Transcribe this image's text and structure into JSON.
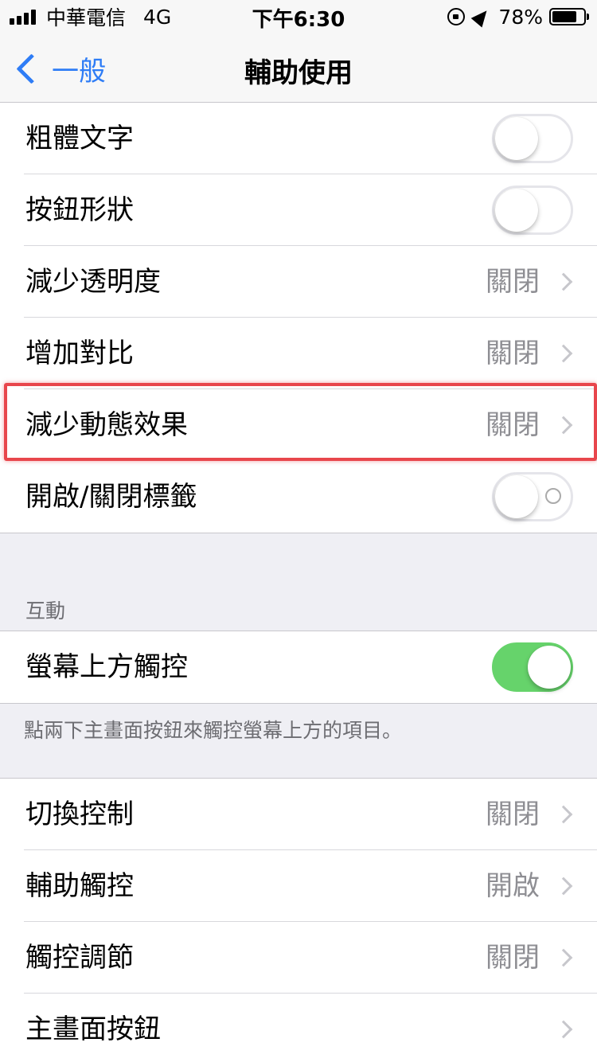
{
  "status_bar": {
    "carrier": "中華電信",
    "network": "4G",
    "time": "下午6:30",
    "battery_percent": "78%",
    "battery_level": 0.78
  },
  "nav": {
    "back_label": "一般",
    "title": "輔助使用"
  },
  "group1": {
    "rows": [
      {
        "label": "粗體文字",
        "type": "toggle",
        "on": false
      },
      {
        "label": "按鈕形狀",
        "type": "toggle",
        "on": false
      },
      {
        "label": "減少透明度",
        "type": "link",
        "value": "關閉"
      },
      {
        "label": "增加對比",
        "type": "link",
        "value": "關閉"
      },
      {
        "label": "減少動態效果",
        "type": "link",
        "value": "關閉"
      },
      {
        "label": "開啟/關閉標籤",
        "type": "toggle",
        "on": false
      }
    ]
  },
  "interaction": {
    "header": "互動",
    "row": {
      "label": "螢幕上方觸控",
      "type": "toggle",
      "on": true
    },
    "footer": "點兩下主畫面按鈕來觸控螢幕上方的項目。"
  },
  "group3": {
    "rows": [
      {
        "label": "切換控制",
        "value": "關閉"
      },
      {
        "label": "輔助觸控",
        "value": "開啟"
      },
      {
        "label": "觸控調節",
        "value": "關閉"
      },
      {
        "label": "主畫面按鈕",
        "value": ""
      }
    ]
  },
  "colors": {
    "accent": "#2f7df6",
    "toggle_on": "#66d36b",
    "highlight": "#e8464c"
  }
}
